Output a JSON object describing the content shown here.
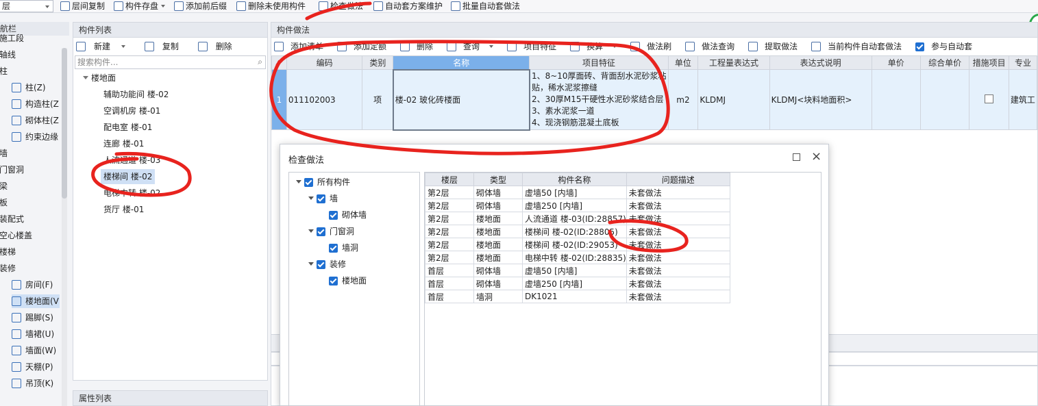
{
  "toolbar": {
    "floor": "层",
    "items": [
      "层间复制",
      "构件存盘",
      "添加前后缀",
      "删除未使用构件",
      "检查做法",
      "自动套方案维护",
      "批量自动套做法"
    ]
  },
  "nav": {
    "title": "航栏",
    "items": [
      {
        "label": "施工段",
        "kind": "cat"
      },
      {
        "label": "轴线",
        "kind": "cat"
      },
      {
        "label": "柱",
        "kind": "cat"
      },
      {
        "label": "柱(Z)",
        "kind": "sub",
        "icon": "column-icon"
      },
      {
        "label": "构造柱(Z",
        "kind": "sub",
        "icon": "gear-column-icon"
      },
      {
        "label": "砌体柱(Z",
        "kind": "sub",
        "icon": "masonry-column-icon"
      },
      {
        "label": "约束边缘",
        "kind": "sub",
        "icon": "edge-icon"
      },
      {
        "label": "墙",
        "kind": "cat"
      },
      {
        "label": "门窗洞",
        "kind": "cat"
      },
      {
        "label": "梁",
        "kind": "cat"
      },
      {
        "label": "板",
        "kind": "cat"
      },
      {
        "label": "装配式",
        "kind": "cat"
      },
      {
        "label": "空心楼盖",
        "kind": "cat"
      },
      {
        "label": "楼梯",
        "kind": "cat"
      },
      {
        "label": "装修",
        "kind": "cat"
      },
      {
        "label": "房间(F)",
        "kind": "sub",
        "icon": "room-icon"
      },
      {
        "label": "楼地面(V",
        "kind": "sub",
        "icon": "floor-icon",
        "selected": true
      },
      {
        "label": "踢脚(S)",
        "kind": "sub",
        "icon": "skirting-icon"
      },
      {
        "label": "墙裙(U)",
        "kind": "sub",
        "icon": "dado-icon"
      },
      {
        "label": "墙面(W)",
        "kind": "sub",
        "icon": "wall-surface-icon"
      },
      {
        "label": "天棚(P)",
        "kind": "sub",
        "icon": "ceiling-icon"
      },
      {
        "label": "吊顶(K)",
        "kind": "sub",
        "icon": "suspended-ceiling-icon"
      }
    ]
  },
  "component_list": {
    "title": "构件列表",
    "new_label": "新建",
    "copy_label": "复制",
    "delete_label": "删除",
    "search_placeholder": "搜索构件...",
    "tree_root": "楼地面",
    "tree_items": [
      "辅助功能间 楼-02",
      "空调机房 楼-01",
      "配电室 楼-01",
      "连廊 楼-01",
      "人流通道 楼-03",
      "楼梯间 楼-02",
      "电梯中转 楼-02",
      "货厅 楼-01"
    ],
    "selected_index": 5
  },
  "property_list": {
    "title": "属性列表"
  },
  "method_panel": {
    "title": "构件做法",
    "tools": [
      "添加清单",
      "添加定额",
      "删除",
      "查询",
      "项目特征",
      "换算",
      "做法刷",
      "做法查询",
      "提取做法",
      "当前构件自动套做法",
      "参与自动套"
    ],
    "columns": [
      "编码",
      "类别",
      "名称",
      "项目特征",
      "单位",
      "工程量表达式",
      "表达式说明",
      "单价",
      "综合单价",
      "措施项目",
      "专业"
    ],
    "row": {
      "no": "1",
      "code": "011102003",
      "category": "项",
      "name": "楼-02  玻化砖楼面",
      "features": [
        "1、8~10厚面砖、背面刮水泥砂浆粘",
        "贴，稀水泥浆擦缝",
        "2、30厚M15干硬性水泥砂浆结合层",
        "3、素水泥浆一道",
        "4、现浇钢筋混凝土底板"
      ],
      "unit": "m2",
      "expression": "KLDMJ",
      "expression_desc": "KLDMJ<块料地面积>",
      "unit_price": "",
      "composite_price": "",
      "specialty": "建筑工"
    }
  },
  "dialog": {
    "title": "检查做法",
    "tree": [
      {
        "label": "所有构件",
        "level": 0,
        "expandable": true
      },
      {
        "label": "墙",
        "level": 1,
        "expandable": true
      },
      {
        "label": "砌体墙",
        "level": 2,
        "expandable": false
      },
      {
        "label": "门窗洞",
        "level": 1,
        "expandable": true
      },
      {
        "label": "墙洞",
        "level": 2,
        "expandable": false
      },
      {
        "label": "装修",
        "level": 1,
        "expandable": true
      },
      {
        "label": "楼地面",
        "level": 2,
        "expandable": false
      }
    ],
    "columns": [
      "楼层",
      "类型",
      "构件名称",
      "问题描述"
    ],
    "rows": [
      [
        "第2层",
        "砌体墙",
        "虚墙50 [内墙]",
        "未套做法"
      ],
      [
        "第2层",
        "砌体墙",
        "虚墙250 [内墙]",
        "未套做法"
      ],
      [
        "第2层",
        "楼地面",
        "人流通道 楼-03(ID:28857)",
        "未套做法"
      ],
      [
        "第2层",
        "楼地面",
        "楼梯间 楼-02(ID:28805)",
        "未套做法"
      ],
      [
        "第2层",
        "楼地面",
        "楼梯间 楼-02(ID:29053)",
        "未套做法"
      ],
      [
        "第2层",
        "楼地面",
        "电梯中转 楼-02(ID:28835)",
        "未套做法"
      ],
      [
        "首层",
        "砌体墙",
        "虚墙50 [内墙]",
        "未套做法"
      ],
      [
        "首层",
        "砌体墙",
        "虚墙250 [内墙]",
        "未套做法"
      ],
      [
        "首层",
        "墙洞",
        "DK1021",
        "未套做法"
      ]
    ]
  },
  "colors": {
    "accent": "#1f6fd1",
    "header_highlight": "#7bb0ea",
    "annotation": "#e8231e"
  }
}
